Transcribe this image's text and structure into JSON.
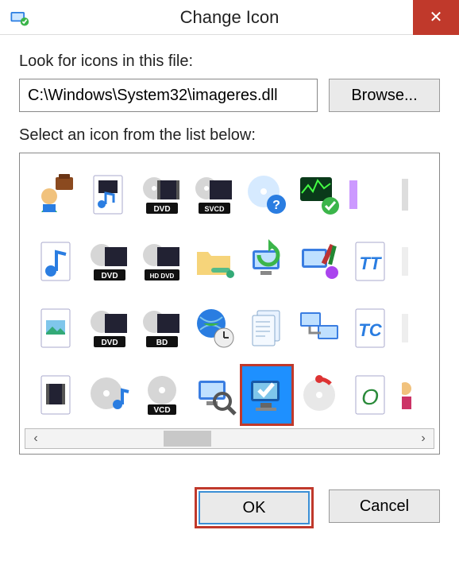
{
  "title": "Change Icon",
  "close_glyph": "✕",
  "look_label": "Look for icons in this file:",
  "path_value": "C:\\Windows\\System32\\imageres.dll",
  "browse_label": "Browse...",
  "select_label": "Select an icon from the list below:",
  "scroll": {
    "left_glyph": "‹",
    "right_glyph": "›"
  },
  "buttons": {
    "ok": "OK",
    "cancel": "Cancel"
  },
  "icons": {
    "r0": [
      "user-briefcase-icon",
      "media-file-icon",
      "dvd-video-icon",
      "svcd-video-icon",
      "disc-help-icon",
      "perfmon-ok-icon",
      "partial-icon-a",
      "partial-icon-b"
    ],
    "r1": [
      "music-file-icon",
      "dvd-disc-video-icon",
      "hddvd-video-icon",
      "folder-network-icon",
      "pc-refresh-icon",
      "pc-paint-tools-icon",
      "font-tt-file-icon",
      "partial-icon-c"
    ],
    "r2": [
      "picture-file-icon",
      "dvd-video-icon-b",
      "bd-video-icon",
      "globe-clock-icon",
      "documents-stack-icon",
      "pc-network-icon",
      "font-tc-file-icon",
      "partial-icon-d"
    ],
    "r3": [
      "film-file-icon",
      "music-disc-icon",
      "vcd-disc-icon",
      "pc-search-icon",
      "pc-checkmark-icon",
      "progress-disc-icon",
      "zero-file-icon",
      "partial-user-icon"
    ]
  },
  "selected_icon": "pc-checkmark-icon",
  "disc_labels": {
    "dvd": "DVD",
    "svcd": "SVCD",
    "hddvd": "HD DVD",
    "bd": "BD",
    "vcd": "VCD"
  },
  "file_glyphs": {
    "tt": "TT",
    "tc": "TC",
    "o": "O"
  }
}
